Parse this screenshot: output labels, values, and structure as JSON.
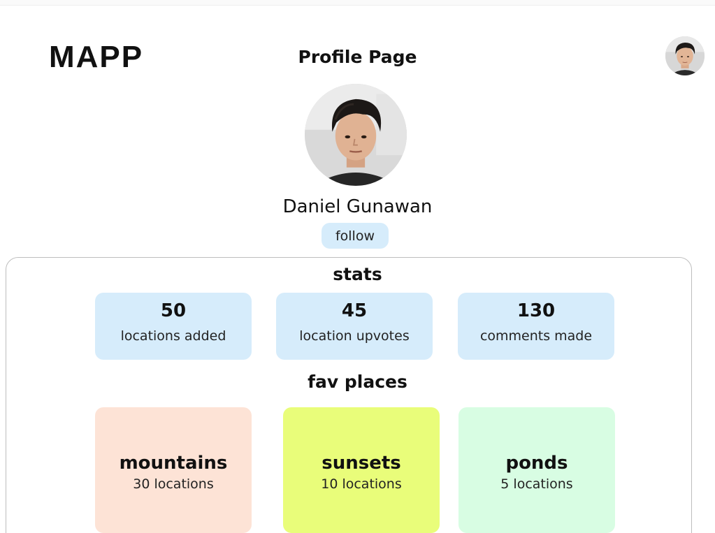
{
  "header": {
    "logo": "MAPP",
    "page_title": "Profile Page"
  },
  "profile": {
    "name": "Daniel Gunawan",
    "follow_label": "follow"
  },
  "stats": {
    "title": "stats",
    "items": [
      {
        "value": "50",
        "label": "locations added"
      },
      {
        "value": "45",
        "label": "location upvotes"
      },
      {
        "value": "130",
        "label": "comments made"
      }
    ]
  },
  "favorites": {
    "title": "fav places",
    "items": [
      {
        "name": "mountains",
        "count": "30 locations",
        "color": "#fde3d6"
      },
      {
        "name": "sunsets",
        "count": "10 locations",
        "color": "#e9fd7a"
      },
      {
        "name": "ponds",
        "count": "5 locations",
        "color": "#d8fde3"
      }
    ]
  },
  "colors": {
    "accent_blue": "#d6ecfb",
    "panel_border": "#bdbdbd"
  }
}
